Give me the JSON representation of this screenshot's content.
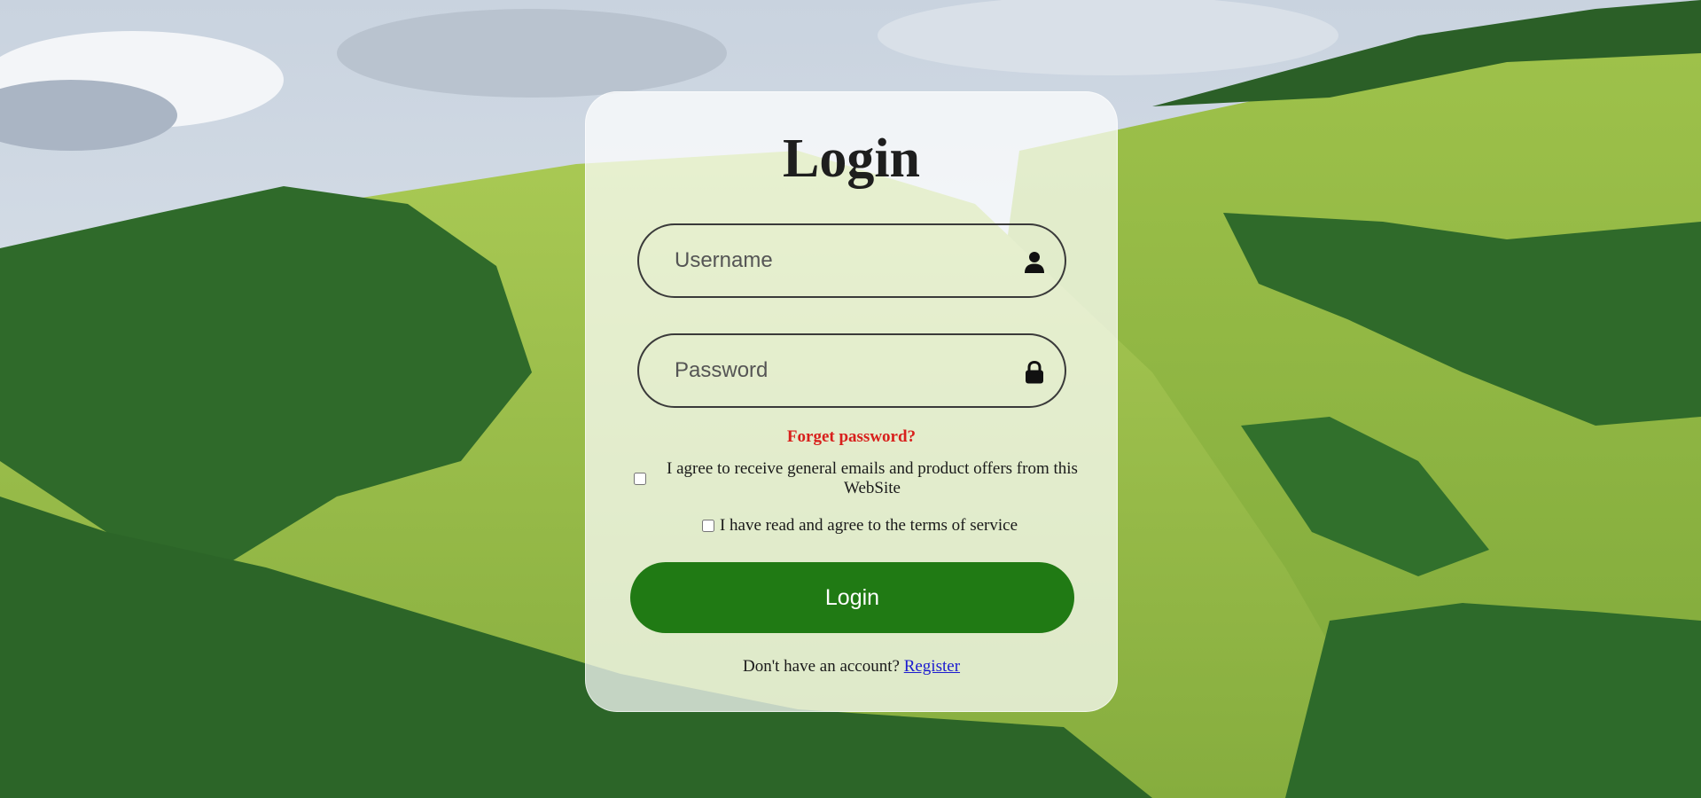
{
  "login": {
    "title": "Login",
    "username_placeholder": "Username",
    "password_placeholder": "Password",
    "forgot_password": "Forget password?",
    "agree_emails": "I agree to receive general emails and product offers from this WebSite",
    "agree_terms": "I have read and agree to the terms of service",
    "submit_label": "Login",
    "no_account_text": "Don't have an account?",
    "register_link": "Register"
  },
  "icons": {
    "username": "user-icon",
    "password": "lock-icon"
  },
  "colors": {
    "button": "#207a14",
    "forgot_link": "#d8201c",
    "register_link": "#1b1bd0"
  },
  "checkboxes": {
    "agree_emails_checked": false,
    "agree_terms_checked": false
  }
}
